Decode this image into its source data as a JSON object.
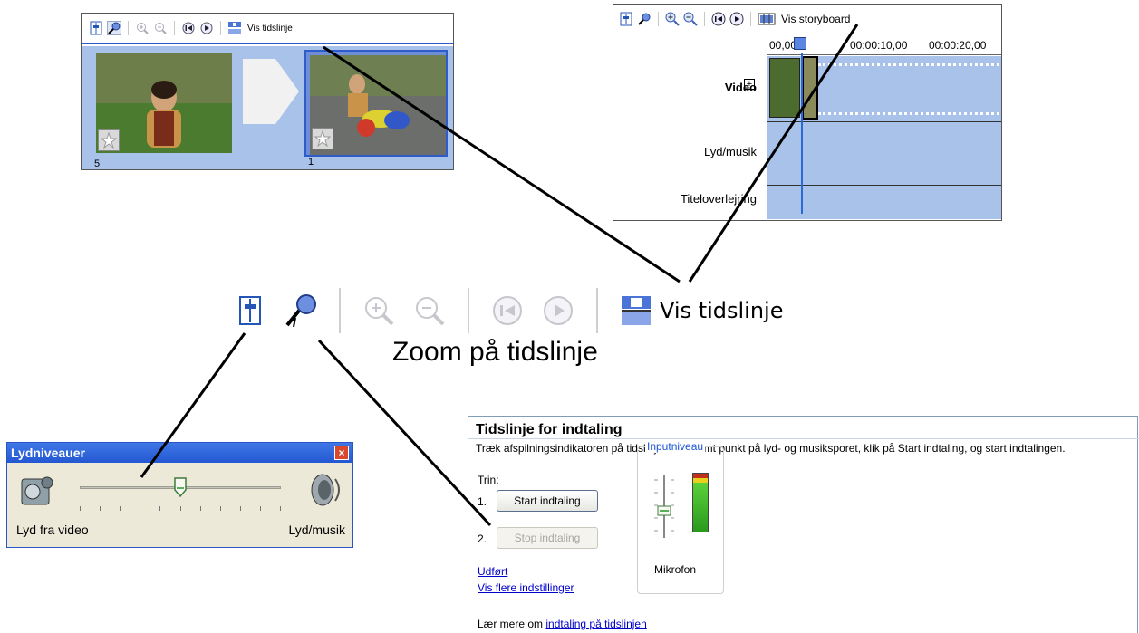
{
  "storyboard": {
    "toolbar_label": "Vis tidslinje",
    "clips": [
      {
        "number": "5"
      },
      {
        "number": "1"
      }
    ]
  },
  "timeline": {
    "toolbar_label": "Vis storyboard",
    "ruler_ticks": [
      "00,00",
      "00:00:10,00",
      "00:00:20,00"
    ],
    "tracks": {
      "video": "Video",
      "audio": "Lyd/musik",
      "title": "Titeloverlejring"
    }
  },
  "main_toolbar": {
    "view_label": "Vis tidslinje",
    "caption": "Zoom på tidslinje"
  },
  "lydniveauer": {
    "title": "Lydniveauer",
    "left_label": "Lyd fra video",
    "right_label": "Lyd/musik",
    "close": "×",
    "slider_position": 0.5
  },
  "narration": {
    "title": "Tidslinje for indtaling",
    "description": "Træk afspilningsindikatoren på tidslinjen til et tomt punkt på lyd- og musiksporet, klik på Start indtaling, og start indtalingen.",
    "steps_label": "Trin:",
    "step1_num": "1.",
    "step1_button": "Start indtaling",
    "step2_num": "2.",
    "step2_button": "Stop indtaling",
    "done_link": "Udført",
    "more_settings_link": "Vis flere indstillinger",
    "input_level_title": "Inputniveau",
    "microphone_label": "Mikrofon",
    "learn_more_prefix": "Lær mere om ",
    "learn_more_link": "indtaling på tidslinjen"
  }
}
